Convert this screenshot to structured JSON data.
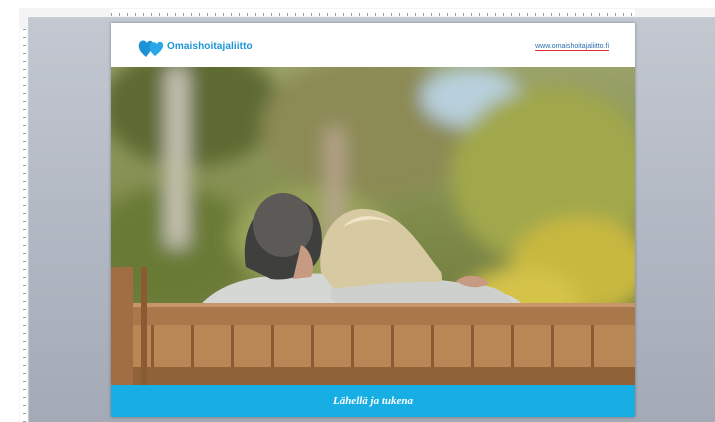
{
  "slide": {
    "logo_text": "Omaishoitajaliitto",
    "url": "www.omaishoitajaliitto.fi",
    "banner_text": "Lähellä ja tukena"
  },
  "icons": {
    "logo": "heart-pair-icon"
  },
  "colors": {
    "brand_blue": "#1d93d6",
    "banner_blue": "#17aee4",
    "workspace_gray": "#b3b9c4"
  }
}
